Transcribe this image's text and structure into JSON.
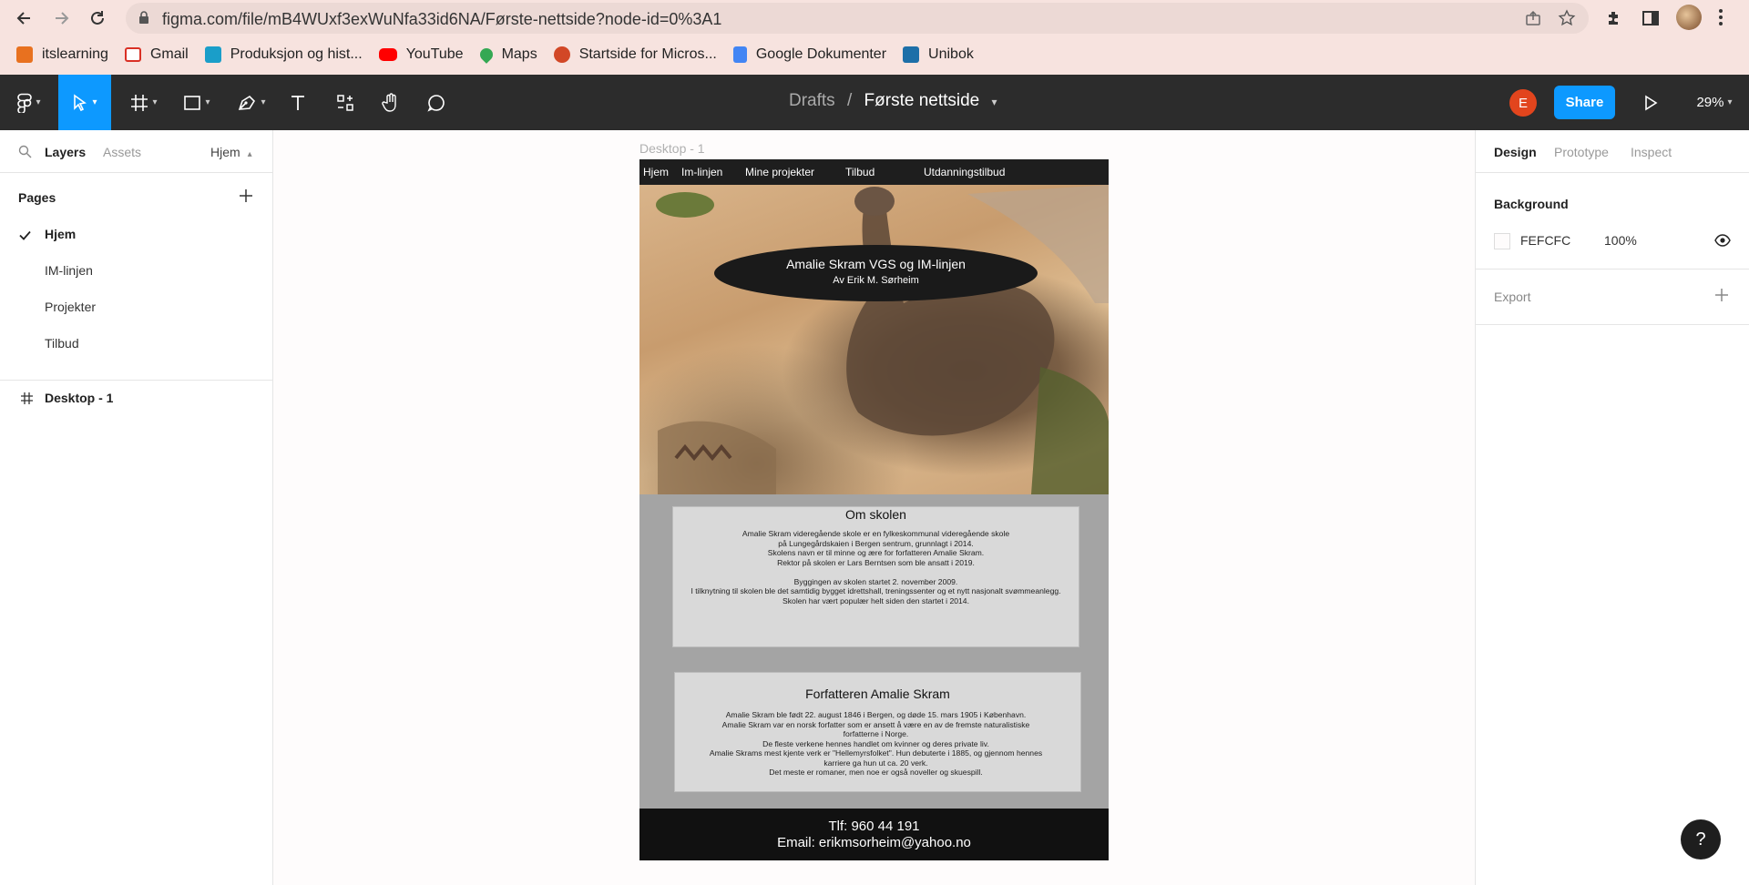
{
  "browser": {
    "url": "figma.com/file/mB4WUxf3exWuNfa33id6NA/Første-nettside?node-id=0%3A1",
    "bookmarks": [
      {
        "label": "itslearning",
        "color": "#e8711f"
      },
      {
        "label": "Gmail",
        "color": "#d93025"
      },
      {
        "label": "Produksjon og hist...",
        "color": "#1a9ec9"
      },
      {
        "label": "YouTube",
        "color": "#ff0000"
      },
      {
        "label": "Maps",
        "color": "#34a853"
      },
      {
        "label": "Startside for Micros...",
        "color": "#d24726"
      },
      {
        "label": "Google Dokumenter",
        "color": "#4285f4"
      },
      {
        "label": "Unibok",
        "color": "#1d6fa8"
      }
    ]
  },
  "toolbar": {
    "drafts": "Drafts",
    "separator": "/",
    "file_name": "Første nettside",
    "avatar_letter": "E",
    "share_label": "Share",
    "zoom": "29%"
  },
  "left_panel": {
    "tabs": [
      "Layers",
      "Assets"
    ],
    "current_page": "Hjem",
    "pages_heading": "Pages",
    "pages": [
      "Hjem",
      "IM-linjen",
      "Projekter",
      "Tilbud"
    ],
    "selected_page": "Hjem",
    "layers": [
      "Desktop - 1"
    ]
  },
  "right_panel": {
    "tabs": [
      "Design",
      "Prototype",
      "Inspect"
    ],
    "background_heading": "Background",
    "background_color": "FEFCFC",
    "background_opacity": "100%",
    "export_heading": "Export"
  },
  "canvas": {
    "frame_label": "Desktop - 1",
    "nav": [
      "Hjem",
      "Im-linjen",
      "Mine projekter",
      "Tilbud",
      "Utdanningstilbud"
    ],
    "hero_title": "Amalie Skram VGS og IM-linjen",
    "hero_subtitle": "Av Erik M. Sørheim",
    "box1": {
      "title": "Om skolen",
      "lines": [
        "Amalie Skram videregående skole er en fylkeskommunal videregående skole",
        "på Lungegårdskaien i Bergen sentrum, grunnlagt i 2014.",
        "Skolens navn er til minne og ære for forfatteren Amalie Skram.",
        "Rektor på skolen er Lars Berntsen som ble ansatt i 2019.",
        "",
        "Byggingen av skolen startet 2. november 2009.",
        "I tilknytning til skolen ble det samtidig bygget idrettshall, treningssenter og et nytt nasjonalt svømmeanlegg.",
        "Skolen har vært populær helt siden den startet i 2014."
      ]
    },
    "box2": {
      "title": "Forfatteren Amalie Skram",
      "lines": [
        "Amalie Skram ble født 22. august 1846 i Bergen, og døde 15. mars 1905 i København.",
        "Amalie Skram var en norsk forfatter som er ansett å være en av de fremste naturalistiske",
        "forfatterne i Norge.",
        "De fleste verkene hennes handlet om kvinner og deres private liv.",
        "Amalie Skrams mest kjente verk er \"Hellemyrsfolket\". Hun debuterte i 1885, og gjennom hennes",
        "karriere ga hun ut ca. 20 verk.",
        "Det meste er romaner, men noe er også noveller og skuespill."
      ]
    },
    "footer_phone": "Tlf: 960 44 191",
    "footer_email": "Email: erikmsorheim@yahoo.no"
  },
  "help_label": "?"
}
